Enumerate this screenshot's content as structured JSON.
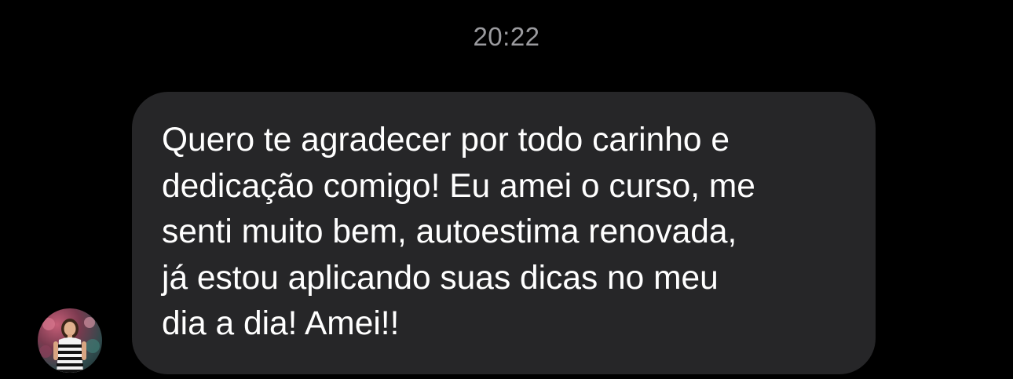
{
  "conversation": {
    "timestamp": "20:22",
    "messages": [
      {
        "sender": "contact",
        "avatar_icon": "user-avatar-photo",
        "bubble_color": "#262628",
        "text": "Quero te agradecer por todo carinho e\ndedicação comigo! Eu amei o curso, me\nsenti muito bem, autoestima renovada,\njá estou aplicando suas dicas no meu\ndia a dia! Amei!!"
      }
    ]
  },
  "colors": {
    "background": "#000000",
    "timestamp": "#9b9b9f",
    "message_text": "#ffffff"
  }
}
